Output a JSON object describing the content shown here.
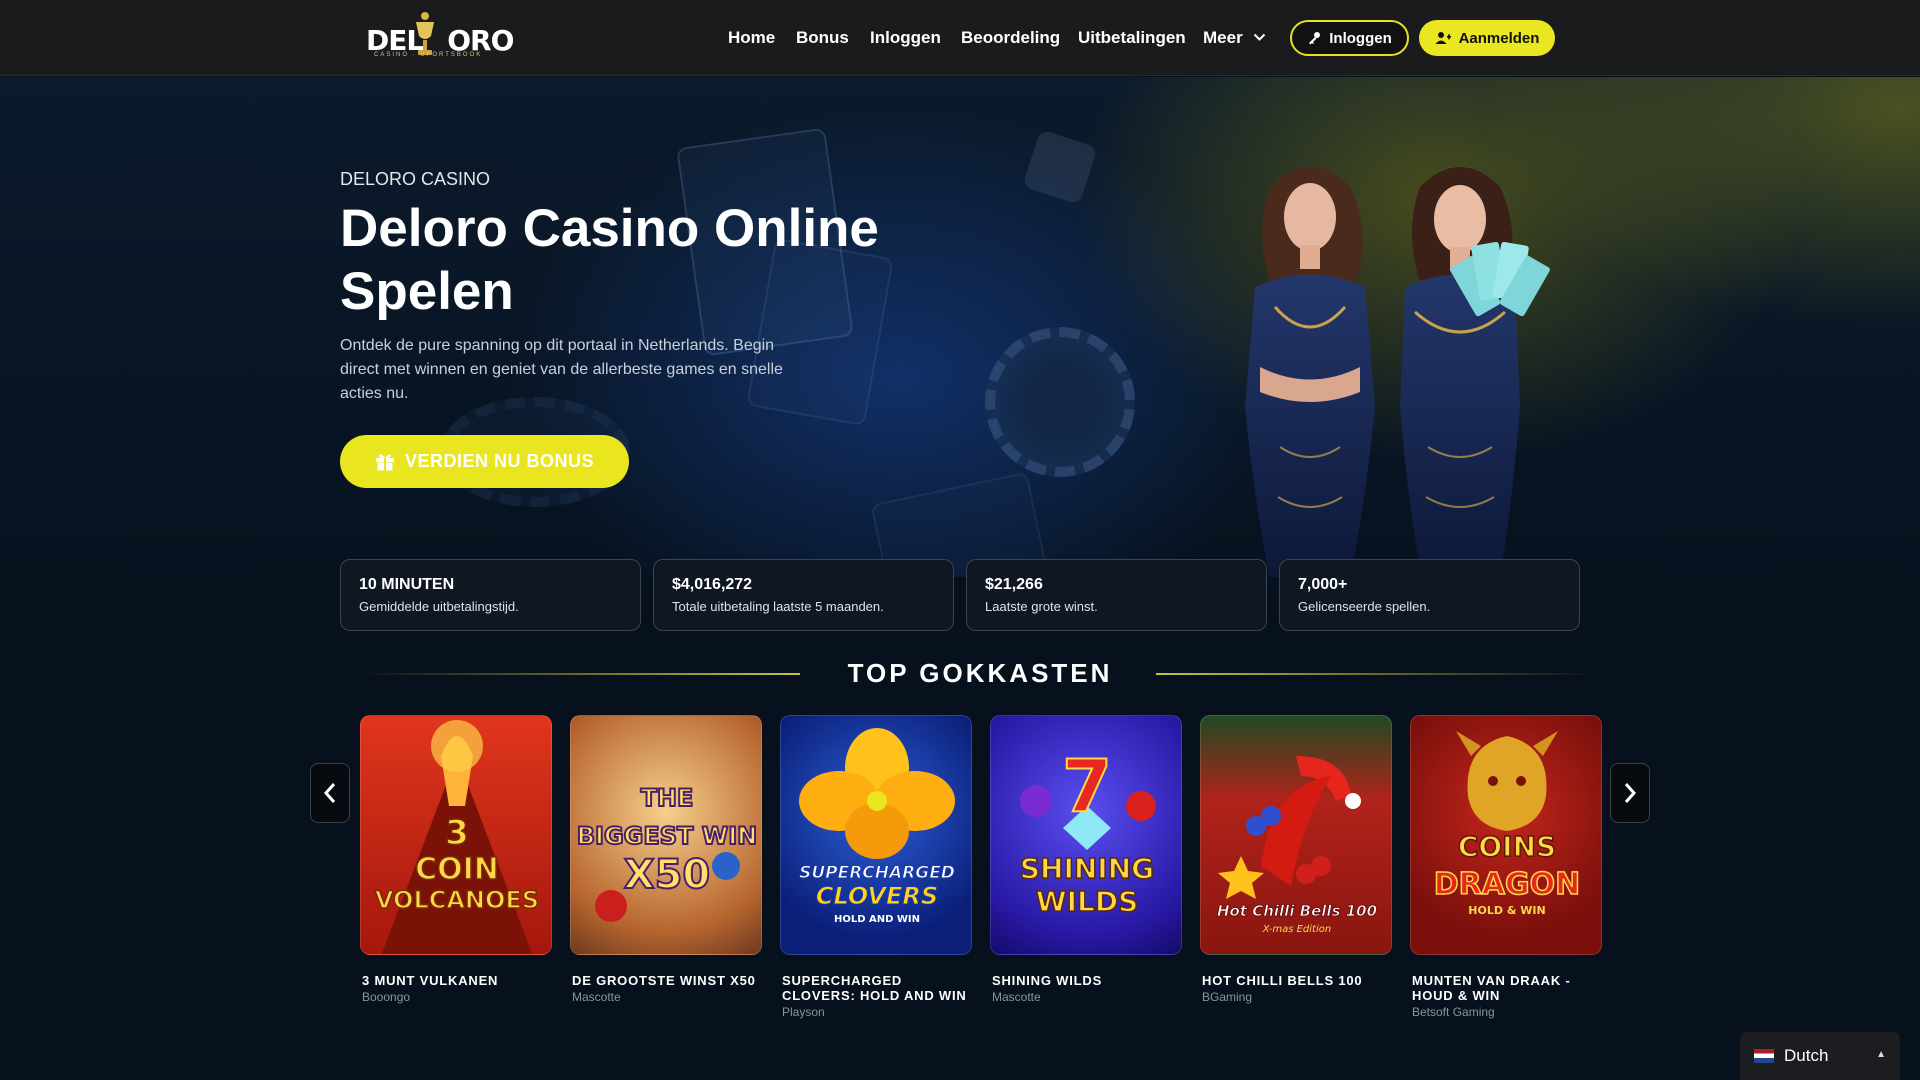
{
  "header": {
    "logo_text_left": "DEL",
    "logo_text_right": "ORO",
    "logo_sub": "CASINO · SPORTSBOOK",
    "nav": [
      "Home",
      "Bonus",
      "Inloggen",
      "Beoordeling",
      "Uitbetalingen",
      "Meer"
    ],
    "login_label": "Inloggen",
    "signup_label": "Aanmelden"
  },
  "hero": {
    "eyebrow": "DELORO CASINO",
    "title": "Deloro Casino Online Spelen",
    "text": "Ontdek de pure spanning op dit portaal in Netherlands. Begin direct met winnen en geniet van de allerbeste games en snelle acties nu.",
    "cta_label": "VERDIEN NU BONUS"
  },
  "stats": [
    {
      "value": "10 MINUTEN",
      "label": "Gemiddelde uitbetalingstijd."
    },
    {
      "value": "$4,016,272",
      "label": "Totale uitbetaling laatste 5 maanden."
    },
    {
      "value": "$21,266",
      "label": "Laatste grote winst."
    },
    {
      "value": "7,000+",
      "label": "Gelicenseerde spellen."
    }
  ],
  "section": {
    "title": "TOP GOKKASTEN"
  },
  "games": [
    {
      "name": "3 MUNT VULKANEN",
      "provider": "Booongo",
      "art_line1": "3",
      "art_line2": "COIN",
      "art_line3": "VOLCANOES"
    },
    {
      "name": "DE GROOTSTE WINST X50",
      "provider": "Mascotte",
      "art_line1": "THE",
      "art_line2": "BIGGEST WIN",
      "art_line3": "X50"
    },
    {
      "name": "SUPERCHARGED CLOVERS: HOLD AND WIN",
      "provider": "Playson",
      "art_line1": "SUPERCHARGED",
      "art_line2": "CLOVERS",
      "art_line3": "HOLD AND WIN"
    },
    {
      "name": "SHINING WILDS",
      "provider": "Mascotte",
      "art_line1": "7",
      "art_line2": "SHINING",
      "art_line3": "WILDS"
    },
    {
      "name": "HOT CHILLI BELLS 100",
      "provider": "BGaming",
      "art_line1": "Hot Chilli Bells 100",
      "art_line2": "X-mas Edition",
      "art_line3": ""
    },
    {
      "name": "MUNTEN VAN DRAAK - HOUD & WIN",
      "provider": "Betsoft Gaming",
      "art_line1": "COINS",
      "art_line2": "DRAGON",
      "art_line3": "HOLD & WIN"
    }
  ],
  "language": {
    "label": "Dutch"
  },
  "colors": {
    "accent": "#eae621",
    "header_bg": "#1a1b1d",
    "page_bg": "#07111d"
  }
}
